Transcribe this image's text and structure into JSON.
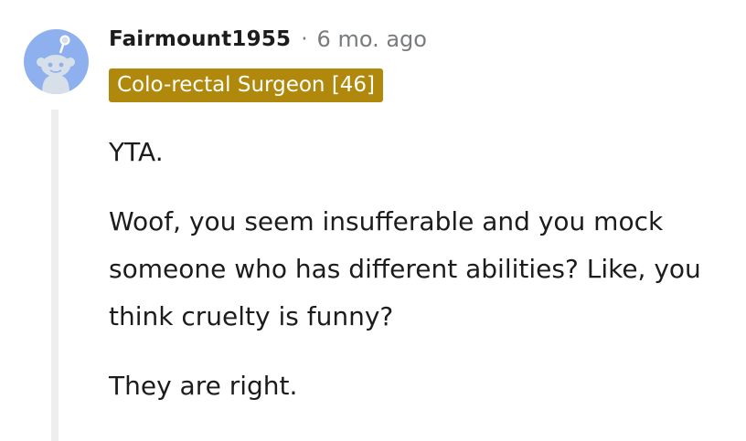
{
  "comment": {
    "username": "Fairmount1955",
    "separator": "·",
    "timestamp": "6 mo. ago",
    "flair": "Colo-rectal Surgeon [46]",
    "avatar_icon": "reddit-snoo-icon",
    "body": [
      "YTA.",
      "Woof, you seem insufferable and you mock someone who has different abilities? Like, you think cruelty is funny?",
      "They are right."
    ]
  },
  "colors": {
    "flair_background": "#b0890c",
    "avatar_background": "#8eb0ee",
    "timestamp": "#787c7e",
    "thread_line": "#eeeeee"
  }
}
